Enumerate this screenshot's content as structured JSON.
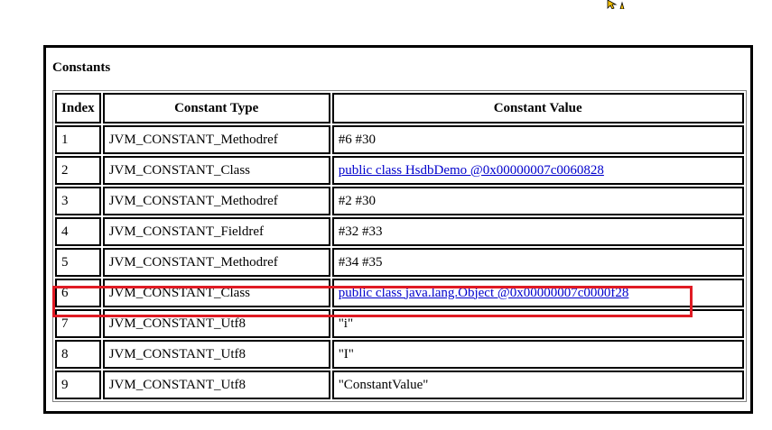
{
  "section_title": "Constants",
  "table": {
    "headers": [
      "Index",
      "Constant Type",
      "Constant Value"
    ],
    "rows": [
      {
        "index": "1",
        "type": "JVM_CONSTANT_Methodref",
        "value": "#6 #30",
        "link": false
      },
      {
        "index": "2",
        "type": "JVM_CONSTANT_Class",
        "value": "public class HsdbDemo @0x00000007c0060828",
        "link": true
      },
      {
        "index": "3",
        "type": "JVM_CONSTANT_Methodref",
        "value": "#2 #30",
        "link": false
      },
      {
        "index": "4",
        "type": "JVM_CONSTANT_Fieldref",
        "value": "#32 #33",
        "link": false
      },
      {
        "index": "5",
        "type": "JVM_CONSTANT_Methodref",
        "value": "#34 #35",
        "link": false
      },
      {
        "index": "6",
        "type": "JVM_CONSTANT_Class",
        "value": "public class java.lang.Object @0x00000007c0000f28",
        "link": true
      },
      {
        "index": "7",
        "type": "JVM_CONSTANT_Utf8",
        "value": "\"i\"",
        "link": false
      },
      {
        "index": "8",
        "type": "JVM_CONSTANT_Utf8",
        "value": "\"I\"",
        "link": false
      },
      {
        "index": "9",
        "type": "JVM_CONSTANT_Utf8",
        "value": "\"ConstantValue\"",
        "link": false
      }
    ]
  },
  "highlighted_row_index": "6",
  "colors": {
    "link": "#0000cc",
    "highlight_border": "#e01b24",
    "cursor": "#f5c000"
  },
  "icons": {
    "cursor": "pointer-cursor-icon"
  }
}
